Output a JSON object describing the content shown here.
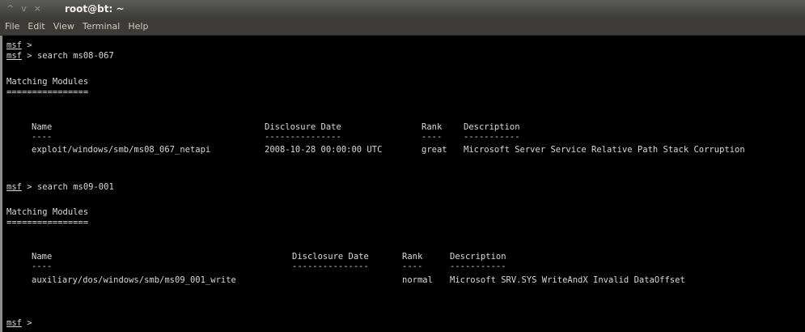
{
  "window": {
    "title": "root@bt: ~",
    "buttons": {
      "up": "^",
      "down": "v",
      "close": "×"
    }
  },
  "menubar": {
    "items": [
      {
        "label": "File"
      },
      {
        "label": "Edit"
      },
      {
        "label": "View"
      },
      {
        "label": "Terminal"
      },
      {
        "label": "Help"
      }
    ]
  },
  "terminal": {
    "prompt": "msf",
    "prompt_suffix": " >",
    "commands": [
      "search ms08-067",
      "search ms09-001"
    ],
    "section_heading": "Matching Modules",
    "heading_rule": "================",
    "column_rule_name": "----",
    "search1": {
      "headers": [
        "Name",
        "Disclosure Date",
        "Rank",
        "Description"
      ],
      "rules": [
        "----",
        "---------------",
        "----",
        "-----------"
      ],
      "rows": [
        {
          "name": "exploit/windows/smb/ms08_067_netapi",
          "date": "2008-10-28 00:00:00 UTC",
          "rank": "great",
          "description": "Microsoft Server Service Relative Path Stack Corruption"
        }
      ]
    },
    "search2": {
      "headers": [
        "Name",
        "Disclosure Date",
        "Rank",
        "Description"
      ],
      "rules": [
        "----",
        "---------------",
        "----",
        "-----------"
      ],
      "rows": [
        {
          "name": "auxiliary/dos/windows/smb/ms09_001_write",
          "date": "",
          "rank": "normal",
          "description": "Microsoft SRV.SYS WriteAndX Invalid DataOffset"
        }
      ]
    }
  },
  "colors": {
    "terminal_bg": "#000000",
    "terminal_fg": "#d8d8d8",
    "titlebar": "#4a4a48"
  }
}
